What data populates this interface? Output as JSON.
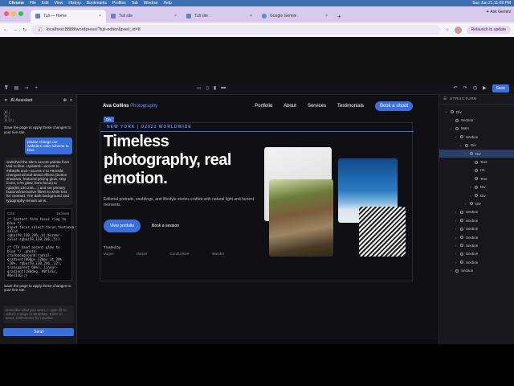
{
  "mac": {
    "apple": "",
    "app": "Chrome",
    "menus": [
      "File",
      "Edit",
      "View",
      "History",
      "Bookmarks",
      "Profiles",
      "Tab",
      "Window",
      "Help"
    ],
    "clock": "Sun Jun 21  11:09 PM"
  },
  "browser": {
    "tabs": [
      {
        "label": "Tuli — Home",
        "active": true
      },
      {
        "label": "Tuli site",
        "active": false
      },
      {
        "label": "Tuli site",
        "active": false
      },
      {
        "label": "Google Gemini",
        "active": false
      }
    ],
    "new_tab": "+",
    "ask": "✦ Ask Gemini",
    "url": "localhost:8888/wordpress/?tuli-editor&post_id=8",
    "relaunch": "Relaunch to update"
  },
  "editor": {
    "save": "Save"
  },
  "ai": {
    "title": "AI Assistant",
    "code_snip": "    });\n  });\n})();",
    "msg1": "Save the page to apply these changes to your live site.",
    "user_msg": "please change our websites color scheme to blue",
    "response": "Switched the site's accent palette from teal to blue. Updated—accent to #3b82f6 and—accent-2 to #93c5fd, changed all teal-tinted effects (button shadows, featured pricing glow, step icons, CTA glow, form focus) to rgba(59,130,246,...) and set primary buttons/interactive filters to white text for contrast. The dark background and typography remain as-is.",
    "code_lang": "CSS",
    "code_lines": "16 lines",
    "code_body": "/* Contact form focus ring to blue */ input:focus,select:focus,textarea:focus{outline:2px solid rgba(59,130,246,.4);border-color:rgba(59,130,246,.5)}\n\n/* CTA band accent glow to blue */ .photo-cta{background:radial-gradient(800px 320px at 20% -20%, rgba(59,130,246,.22), transparent 60%), linear-gradient(180deg, #0f141c, #0e1116);}",
    "msg2": "Save the page to apply these changes to your live site.",
    "placeholder": "Describe what you want — type @ to attach a page or template. Enter to send, Shift+Enter for newline.",
    "send": "Send"
  },
  "site": {
    "brand_a": "Ava Collins ",
    "brand_b": "Photography",
    "nav": [
      "Portfolio",
      "About",
      "Services",
      "Testimonials"
    ],
    "book": "Book a shoot",
    "div_tag": "Div",
    "eyebrow": "NEW YORK | U2022 WORLDWIDE",
    "headline": "Timeless photography, real emotion.",
    "lead": "Editorial portraits, weddings, and lifestyle stories crafted with natural light and honest moments.",
    "cta1": "View portfolio",
    "cta2": "Book a session",
    "trusted": "Trusted by",
    "logos": [
      "Vogue",
      "Harper",
      "CondU00e9",
      "Wander"
    ]
  },
  "structure": {
    "title": "STRUCTURE",
    "nodes": [
      {
        "label": "Div",
        "d": 0,
        "c": "⌄"
      },
      {
        "label": "Section",
        "d": 1,
        "c": "›"
      },
      {
        "label": "Main",
        "d": 1,
        "c": "⌄"
      },
      {
        "label": "Section",
        "d": 2,
        "c": "⌄"
      },
      {
        "label": "Div",
        "d": 3,
        "c": "⌄"
      },
      {
        "label": "Div",
        "d": 4,
        "c": "⌄",
        "sel": true
      },
      {
        "label": "Text",
        "d": 5,
        "c": ""
      },
      {
        "label": "H1",
        "d": 5,
        "c": ""
      },
      {
        "label": "Text",
        "d": 5,
        "c": ""
      },
      {
        "label": "Div",
        "d": 5,
        "c": "›"
      },
      {
        "label": "Div",
        "d": 5,
        "c": "›"
      },
      {
        "label": "Div",
        "d": 4,
        "c": "›"
      },
      {
        "label": "Section",
        "d": 2,
        "c": "›"
      },
      {
        "label": "Section",
        "d": 2,
        "c": "›"
      },
      {
        "label": "Section",
        "d": 2,
        "c": "›"
      },
      {
        "label": "Section",
        "d": 2,
        "c": "›"
      },
      {
        "label": "Section",
        "d": 2,
        "c": "›"
      },
      {
        "label": "Section",
        "d": 2,
        "c": "›"
      },
      {
        "label": "Section",
        "d": 2,
        "c": "›"
      },
      {
        "label": "Section",
        "d": 1,
        "c": "›"
      }
    ]
  }
}
